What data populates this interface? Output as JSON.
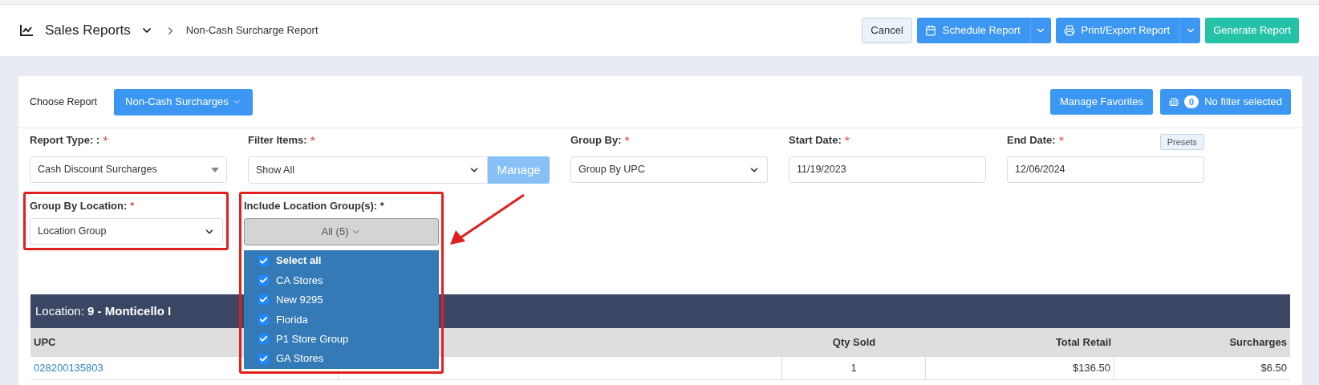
{
  "header": {
    "title": "Sales Reports",
    "breadcrumb": "Non-Cash Surcharge Report",
    "buttons": [
      {
        "label": "Cancel",
        "kind": "plain"
      },
      {
        "label": "Schedule Report",
        "kind": "split"
      },
      {
        "label": "Print/Export Report",
        "kind": "split"
      },
      {
        "label": "Generate Report",
        "kind": "success"
      }
    ]
  },
  "choose_report": {
    "label": "Choose Report",
    "value": "Non-Cash Surcharges"
  },
  "favorites_button": "Manage Favorites",
  "filter_badge": {
    "count": "0",
    "label": "No filter selected"
  },
  "fields": [
    {
      "label": "Report Type: :",
      "required_mark": "*",
      "kind": "combo",
      "value": "Cash Discount Surcharges"
    },
    {
      "label": "Filter Items:",
      "required_mark": "*",
      "kind": "select-manage",
      "value": "Show All",
      "action": "Manage"
    },
    {
      "label": "Group By:",
      "required_mark": "*",
      "kind": "select",
      "value": "Group By UPC"
    },
    {
      "label": "Start Date:",
      "required_mark": "*",
      "kind": "date",
      "value": "11/19/2023"
    },
    {
      "label": "End Date:",
      "required_mark": "*",
      "kind": "date",
      "value": "12/06/2024",
      "presets": "Presets"
    }
  ],
  "group_by_location": {
    "label": "Group By Location:",
    "required_mark": "*",
    "value": "Location Group"
  },
  "location_groups": {
    "label": "Include Location Group(s): *",
    "button": "All (5)",
    "expanded": true,
    "options": [
      {
        "label": "Select all",
        "checked": true
      },
      {
        "label": "CA Stores",
        "checked": true
      },
      {
        "label": "New 9295",
        "checked": true
      },
      {
        "label": "Florida",
        "checked": true
      },
      {
        "label": "P1 Store Group",
        "checked": true
      },
      {
        "label": "GA Stores",
        "checked": true
      }
    ]
  },
  "table": {
    "location": "Location: **9 - Monticello I**",
    "columns": [
      "UPC",
      "Qty Sold",
      "Total Retail",
      "Surcharges"
    ],
    "rows": [
      {
        "cells": [
          "028200135803",
          "1",
          "$136.50",
          "$6.50"
        ]
      }
    ]
  }
}
